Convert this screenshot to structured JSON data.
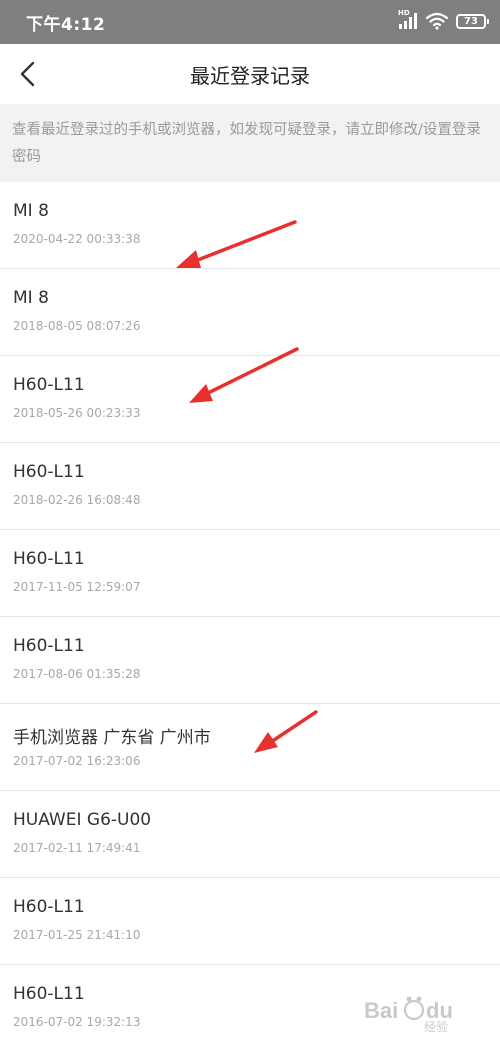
{
  "status_bar": {
    "time": "下午4:12",
    "signal_badge": "HD",
    "battery": "73",
    "icons": [
      "signal-icon",
      "wifi-icon",
      "battery-icon"
    ]
  },
  "nav": {
    "title": "最近登录记录",
    "back_icon": "chevron-left-icon"
  },
  "notice": {
    "text": "查看最近登录过的手机或浏览器，如发现可疑登录，请立即修改/设置登录密码"
  },
  "records": [
    {
      "device": "MI 8",
      "time": "2020-04-22 00:33:38"
    },
    {
      "device": "MI 8",
      "time": "2018-08-05 08:07:26"
    },
    {
      "device": "H60-L11",
      "time": "2018-05-26 00:23:33"
    },
    {
      "device": "H60-L11",
      "time": "2018-02-26 16:08:48"
    },
    {
      "device": "H60-L11",
      "time": "2017-11-05 12:59:07"
    },
    {
      "device": "H60-L11",
      "time": "2017-08-06 01:35:28"
    },
    {
      "device": "手机浏览器 广东省 广州市",
      "time": "2017-07-02 16:23:06"
    },
    {
      "device": "HUAWEI G6-U00",
      "time": "2017-02-11 17:49:41"
    },
    {
      "device": "H60-L11",
      "time": "2017-01-25 21:41:10"
    },
    {
      "device": "H60-L11",
      "time": "2016-07-02 19:32:13"
    }
  ],
  "annotations": {
    "arrow_color": "#e8302f"
  },
  "watermark": {
    "text": "Bai du 经验"
  },
  "colors": {
    "status_bar_bg": "#7f7f7f",
    "notice_bg": "#f2f2f2",
    "divider": "#e6e6e6"
  }
}
